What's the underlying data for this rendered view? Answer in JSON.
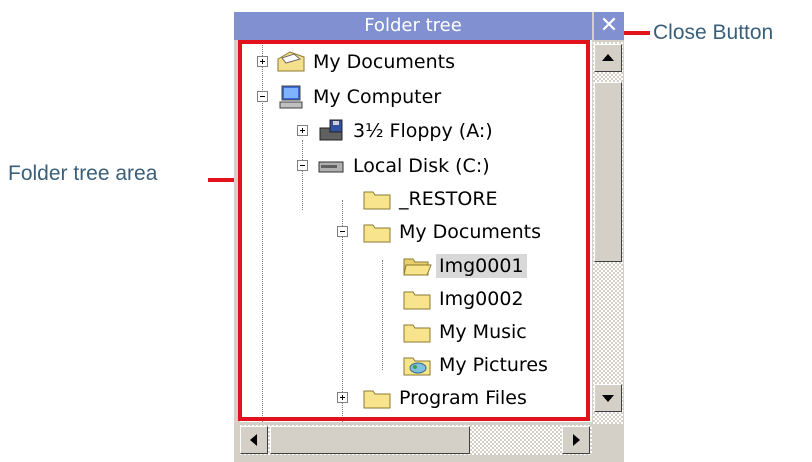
{
  "window": {
    "title": "Folder tree",
    "close_glyph": "✕"
  },
  "callouts": {
    "close_button": "Close Button",
    "tree_area": "Folder tree area"
  },
  "tree": [
    {
      "label": "My Documents",
      "icon": "my-documents-icon",
      "expander": "+",
      "level": 0
    },
    {
      "label": "My Computer",
      "icon": "computer-icon",
      "expander": "-",
      "level": 0
    },
    {
      "label": "3½ Floppy (A:)",
      "icon": "floppy-drive-icon",
      "expander": "+",
      "level": 1
    },
    {
      "label": "Local Disk (C:)",
      "icon": "hard-drive-icon",
      "expander": "-",
      "level": 1
    },
    {
      "label": "_RESTORE",
      "icon": "folder-icon",
      "expander": "",
      "level": 2
    },
    {
      "label": "My Documents",
      "icon": "folder-icon",
      "expander": "-",
      "level": 2
    },
    {
      "label": "Img0001",
      "icon": "folder-open-icon",
      "expander": "",
      "level": 3,
      "selected": true
    },
    {
      "label": "Img0002",
      "icon": "folder-icon",
      "expander": "",
      "level": 3
    },
    {
      "label": "My Music",
      "icon": "folder-icon",
      "expander": "",
      "level": 3
    },
    {
      "label": "My Pictures",
      "icon": "pictures-folder-icon",
      "expander": "",
      "level": 3
    },
    {
      "label": "Program Files",
      "icon": "folder-icon",
      "expander": "+",
      "level": 2
    }
  ],
  "colors": {
    "callout_red": "#e2121c",
    "titlebar": "#8090d0",
    "callout_text": "#3a5f7a"
  }
}
